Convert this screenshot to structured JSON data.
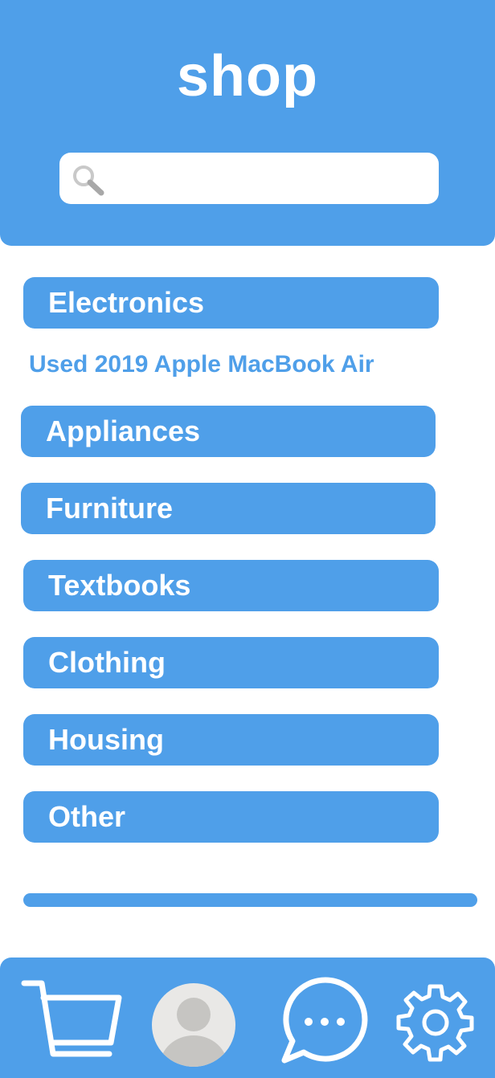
{
  "header": {
    "title": "shop",
    "search": {
      "placeholder": "",
      "value": "",
      "icon": "search-icon"
    }
  },
  "categories": [
    {
      "label": "Electronics"
    },
    {
      "label": "Appliances"
    },
    {
      "label": "Furniture"
    },
    {
      "label": "Textbooks"
    },
    {
      "label": "Clothing"
    },
    {
      "label": "Housing"
    },
    {
      "label": "Other"
    }
  ],
  "electronics_listing": "Used 2019 Apple MacBook Air",
  "bottom_nav": [
    {
      "icon": "cart-icon"
    },
    {
      "icon": "profile-avatar"
    },
    {
      "icon": "chat-icon"
    },
    {
      "icon": "settings-gear-icon"
    }
  ],
  "colors": {
    "accent": "#4f9fe9",
    "background": "#ffffff",
    "avatar_bg": "#e9e8e6",
    "avatar_fg": "#c6c5c2"
  }
}
